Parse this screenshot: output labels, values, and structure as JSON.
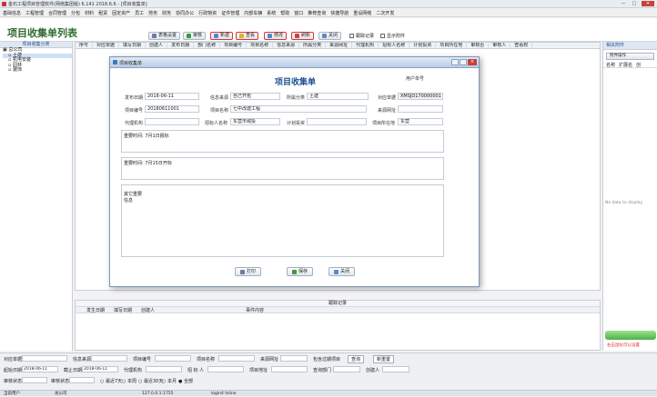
{
  "window": {
    "title": "金石工程项目管理软件(网络集团版) 6.141  2018.6.6 - [项目收集单]",
    "min": "—",
    "max": "□",
    "close": "✕"
  },
  "menu": [
    "基础信息",
    "工程管理",
    "合同管理",
    "分包",
    "材料",
    "租赁",
    "固定资产",
    "员工",
    "劳务",
    "财务",
    "协同办公",
    "行政物资",
    "证件管理",
    "内部车辆",
    "系统",
    "帮助",
    "窗口",
    "推荐查询",
    "快捷导航",
    "重设网络",
    "二次开发"
  ],
  "header": {
    "title": "项目收集单列表"
  },
  "toolbar": [
    {
      "label": "表格设置",
      "color": "#6a7f9a"
    },
    {
      "label": "审核",
      "color": "#3b9a3b"
    },
    {
      "label": "新建",
      "color": "#4a8bd0"
    },
    {
      "label": "查看",
      "color": "#e0b030"
    },
    {
      "label": "修改",
      "color": "#4a8bd0"
    },
    {
      "label": "刷新",
      "color": "#d04040"
    },
    {
      "label": "关闭",
      "color": "#5a8ac0"
    }
  ],
  "toolbar_checks": {
    "follow": "跟踪记录",
    "attach": "显示附件"
  },
  "left": {
    "header": "项目收集分类",
    "tree": [
      "总公司",
      "土建",
      "机电安装",
      "园林",
      "装饰"
    ]
  },
  "grid": {
    "columns": [
      "序号",
      "对应单据",
      "填写日期",
      "创建人",
      "发布日期",
      "部门名称",
      "项目编号",
      "项目名称",
      "信息来源",
      "所属分类",
      "来源网址",
      "代理机构",
      "招标人名称",
      "计划投资",
      "项目所在地",
      "审核否",
      "审核人",
      "查看权"
    ]
  },
  "right": {
    "header": "相关附件",
    "btn": "附件操作",
    "cols": [
      "名称",
      "扩展名",
      "创"
    ],
    "empty": "No data to display"
  },
  "dialog": {
    "title": "项目收集单",
    "heading": "项目收集单",
    "user_label": "用户单号",
    "fields": {
      "release_date_label": "发布日期",
      "release_date": "2018-06-11",
      "source_label": "信息来源",
      "source": "自己开拓",
      "category_label": "所属分类",
      "category": "土建",
      "doc_label": "对应单据",
      "doc": "XMSJD170000001",
      "proj_no_label": "项目编号",
      "proj_no": "20180611001",
      "proj_name_label": "项目名称",
      "proj_name": "七中改建工程",
      "source_url_label": "来源网址",
      "source_url": "",
      "agency_label": "代理机构",
      "agency": "",
      "bidder_label": "招标人名称",
      "bidder": "东营市城投",
      "plan_label": "计划投资",
      "plan": "",
      "location_label": "项目所在地",
      "location": "东营",
      "t1_label": "重要时间:",
      "t1": "7月1日报标",
      "t2_label": "重要时间:",
      "t2": "7月15日开标",
      "note_label": "其它重要信息",
      "note": ""
    },
    "buttons": {
      "print": "打印",
      "save": "保存",
      "close": "关闭"
    }
  },
  "follow": {
    "title": "跟踪记录",
    "cols": [
      "发生日期",
      "填写日期",
      "创建人",
      "事件内容"
    ]
  },
  "filters": {
    "doc": "对应单据",
    "source": "信息来源",
    "proj_no": "项目编号",
    "proj_name": "项目名称",
    "url": "来源网址",
    "incl_expired": "包含过期项目",
    "query": "查询",
    "reset": "新重置",
    "start": "起始日期",
    "start_v": "2018-06-11",
    "end": "截止日期",
    "end_v": "2018-06-11",
    "agency": "代理机构",
    "bidder": "招 标 人",
    "addr": "项目地址",
    "dept": "查询部门",
    "creator": "创建人",
    "audit": "审核状态",
    "audit2": "审核状态",
    "radios": [
      "最近7天",
      "本周",
      "最近30天",
      "本月",
      "全部"
    ]
  },
  "status": {
    "user_label": "当前用户",
    "user": "总公司",
    "ip": "127.0.0.1:1755",
    "login": "login4  Inline"
  },
  "link": "右击鼠标可以设置",
  "colors": {
    "accent": "#2f6b2f",
    "highlight": "#d33"
  }
}
